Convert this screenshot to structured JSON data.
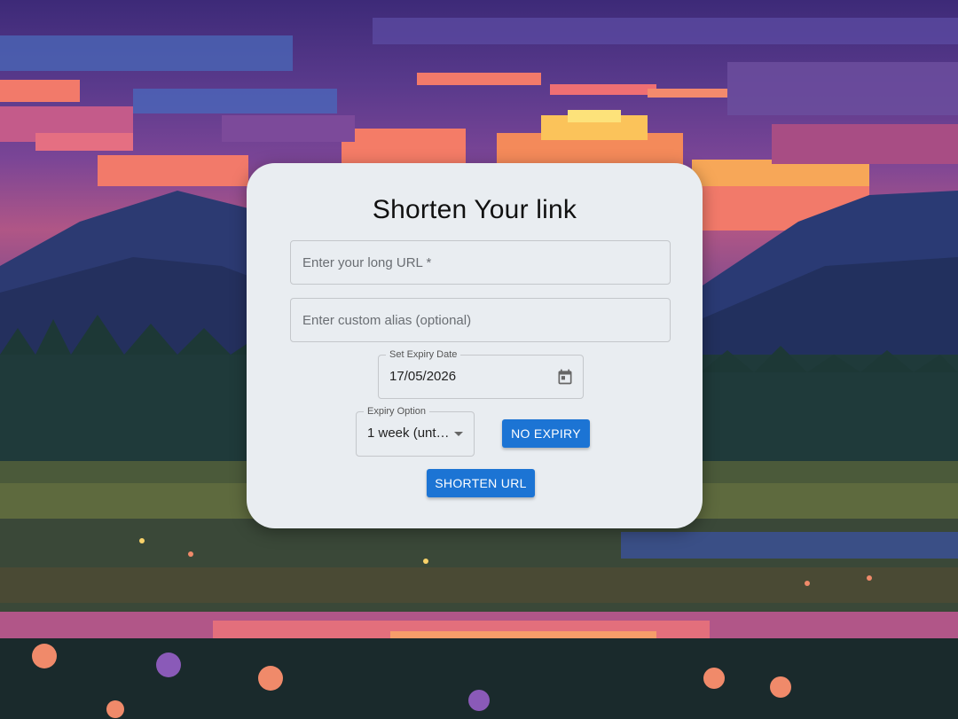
{
  "card": {
    "title": "Shorten Your link"
  },
  "url_field": {
    "placeholder": "Enter your long URL *"
  },
  "alias_field": {
    "placeholder": "Enter custom alias (optional)"
  },
  "expiry_date": {
    "label": "Set Expiry Date",
    "value": "17/05/2026",
    "icon": "calendar-icon"
  },
  "expiry_option": {
    "label": "Expiry Option",
    "selected": "1 week (unt…",
    "icon": "dropdown-arrow-icon"
  },
  "buttons": {
    "no_expiry": "NO EXPIRY",
    "shorten": "SHORTEN URL"
  },
  "colors": {
    "card_bg": "#e9edf1",
    "primary": "#1c74d4"
  }
}
